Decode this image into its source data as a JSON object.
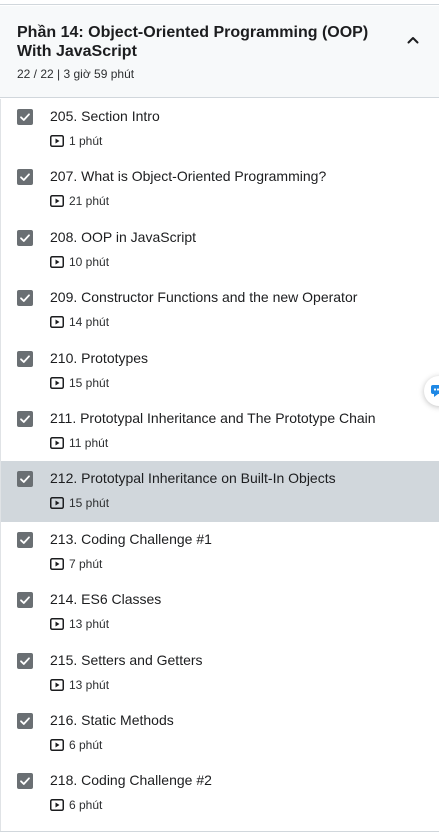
{
  "section": {
    "title": "Phần 14: Object-Oriented Programming (OOP) With JavaScript",
    "meta": "22 / 22 | 3 giờ 59 phút",
    "icons": {
      "collapse": "chevron-up-icon",
      "check": "checkmark-icon",
      "video": "play-video-icon",
      "side_widget": "chat-bubble-icon"
    }
  },
  "lectures": [
    {
      "title": "205. Section Intro",
      "duration": "1 phút",
      "completed": true,
      "active": false
    },
    {
      "title": "207. What is Object-Oriented Programming?",
      "duration": "21 phút",
      "completed": true,
      "active": false
    },
    {
      "title": "208. OOP in JavaScript",
      "duration": "10 phút",
      "completed": true,
      "active": false
    },
    {
      "title": "209. Constructor Functions and the new Operator",
      "duration": "14 phút",
      "completed": true,
      "active": false
    },
    {
      "title": "210. Prototypes",
      "duration": "15 phút",
      "completed": true,
      "active": false
    },
    {
      "title": "211. Prototypal Inheritance and The Prototype Chain",
      "duration": "11 phút",
      "completed": true,
      "active": false
    },
    {
      "title": "212. Prototypal Inheritance on Built-In Objects",
      "duration": "15 phút",
      "completed": true,
      "active": true
    },
    {
      "title": "213. Coding Challenge #1",
      "duration": "7 phút",
      "completed": true,
      "active": false
    },
    {
      "title": "214. ES6 Classes",
      "duration": "13 phút",
      "completed": true,
      "active": false
    },
    {
      "title": "215. Setters and Getters",
      "duration": "13 phút",
      "completed": true,
      "active": false
    },
    {
      "title": "216. Static Methods",
      "duration": "6 phút",
      "completed": true,
      "active": false
    },
    {
      "title": "218. Coding Challenge #2",
      "duration": "6 phút",
      "completed": true,
      "active": false
    }
  ],
  "colors": {
    "active_row": "#d1d7dc",
    "checkbox": "#6a6f73",
    "header_bg": "#f7f9fa",
    "accent": "#1e88e5"
  }
}
